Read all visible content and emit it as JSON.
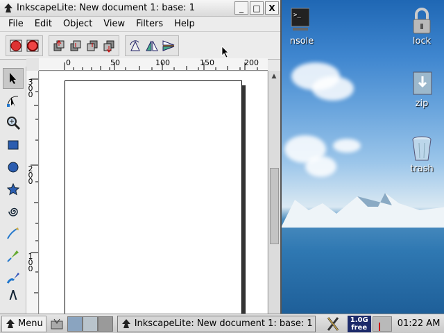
{
  "window": {
    "title": "InkscapeLite: New document 1: base: 1",
    "controls": {
      "minimize": "_",
      "maximize": "□",
      "close": "X"
    }
  },
  "menubar": [
    "File",
    "Edit",
    "Object",
    "View",
    "Filters",
    "Help"
  ],
  "toolbar": {
    "groups": [
      [
        "object-to-path-icon",
        "stroke-to-path-icon"
      ],
      [
        "raise-to-top-icon",
        "raise-icon",
        "lower-icon",
        "lower-to-bottom-icon"
      ],
      [
        "rotate-icon",
        "flip-horizontal-icon",
        "flip-vertical-icon"
      ]
    ]
  },
  "tools": [
    "selector",
    "node",
    "zoom",
    "rectangle",
    "ellipse",
    "star",
    "spiral",
    "pencil",
    "pen",
    "calligraphy",
    "text"
  ],
  "rulers": {
    "horizontal": [
      "0",
      "50",
      "100",
      "150",
      "200"
    ],
    "vertical": [
      "300",
      "200",
      "100"
    ]
  },
  "desktop_icons": [
    {
      "label": "nsole",
      "icon": "console-icon"
    },
    {
      "label": "lock",
      "icon": "lock-icon"
    },
    {
      "label": "zip",
      "icon": "zip-icon"
    },
    {
      "label": "trash",
      "icon": "trash-icon"
    }
  ],
  "taskbar": {
    "menu_label": "Menu",
    "task_label": "InkscapeLite: New document 1: base: 1",
    "memory_line1": "1.0G",
    "memory_line2": "free",
    "clock": "01:22 AM"
  }
}
